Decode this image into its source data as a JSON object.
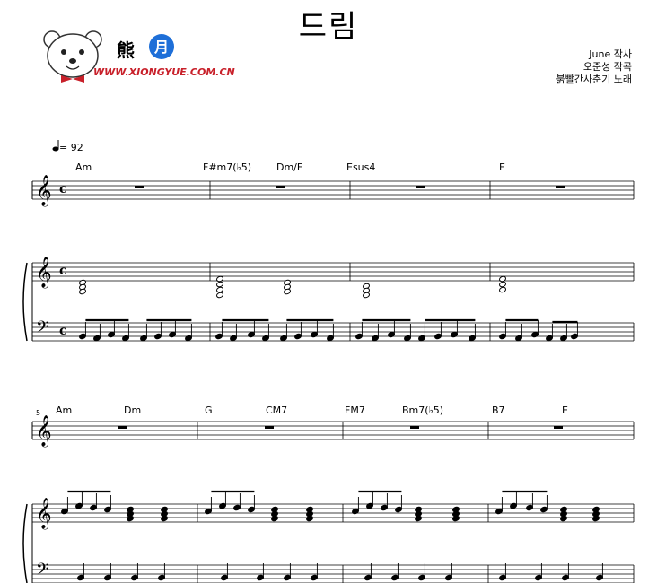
{
  "header": {
    "title": "드림",
    "credits": [
      "June 작사",
      "오준성 작곡",
      "붉빨간사춘기 노래"
    ]
  },
  "logo": {
    "char": "熊",
    "url": "WWW.XIONGYUE.COM.CN"
  },
  "tempo": "= 92",
  "system1": {
    "chords": [
      "Am",
      "F#m7(♭5)",
      "Dm/F",
      "Esus4",
      "E"
    ],
    "time_signature": "c"
  },
  "system2": {
    "measure_number": "5",
    "chords": [
      "Am",
      "Dm",
      "G",
      "CM7",
      "FM7",
      "Bm7(♭5)",
      "B7",
      "E"
    ]
  },
  "colors": {
    "logo_red": "#c8202a",
    "logo_blue": "#1e6fd8"
  }
}
